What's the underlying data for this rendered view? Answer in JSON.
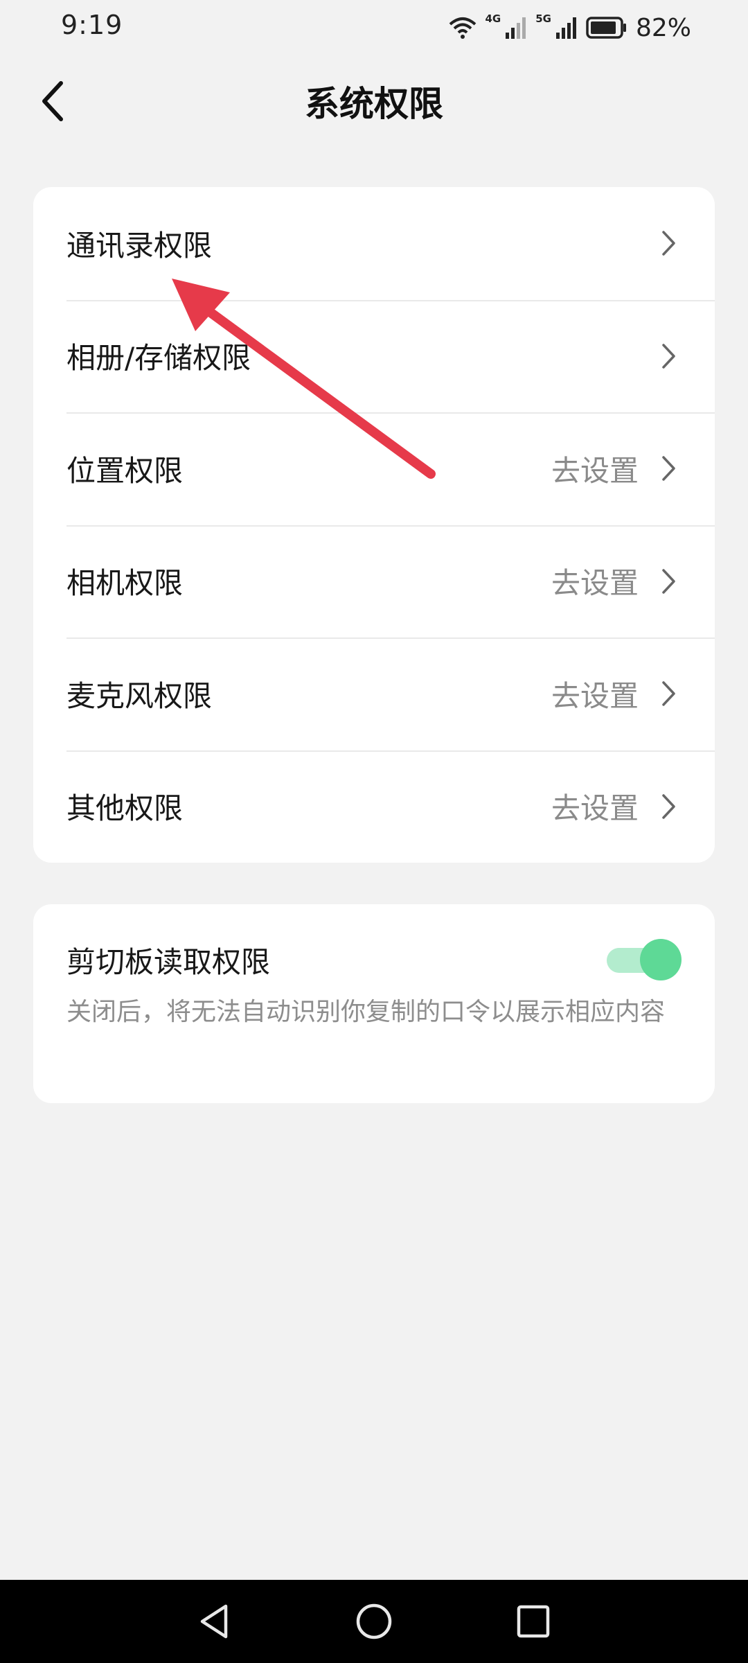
{
  "status_bar": {
    "time": "9:19",
    "network_1": "4G",
    "network_2": "5G",
    "battery_percent": "82%",
    "icons": [
      "wifi-icon",
      "signal-icon",
      "signal-icon",
      "battery-icon"
    ]
  },
  "header": {
    "title": "系统权限",
    "back_icon": "chevron-left-icon"
  },
  "permissions": [
    {
      "label": "通讯录权限",
      "action": ""
    },
    {
      "label": "相册/存储权限",
      "action": ""
    },
    {
      "label": "位置权限",
      "action": "去设置"
    },
    {
      "label": "相机权限",
      "action": "去设置"
    },
    {
      "label": "麦克风权限",
      "action": "去设置"
    },
    {
      "label": "其他权限",
      "action": "去设置"
    }
  ],
  "clipboard": {
    "title": "剪切板读取权限",
    "description": "关闭后，将无法自动识别你复制的口令以展示相应内容",
    "enabled": true
  },
  "annotation": {
    "type": "arrow",
    "color": "#e63a4a"
  },
  "colors": {
    "background": "#f2f2f2",
    "card": "#ffffff",
    "toggle_on": "#5ed996",
    "secondary_text": "#8a8a8a"
  },
  "nav_bar": {
    "buttons": [
      "back-triangle-icon",
      "home-circle-icon",
      "recents-square-icon"
    ]
  }
}
